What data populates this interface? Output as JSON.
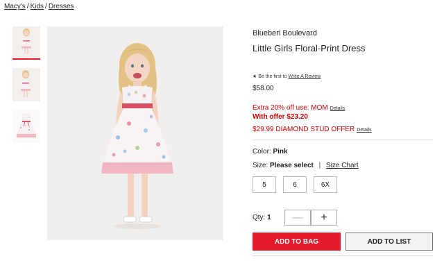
{
  "breadcrumb": {
    "items": [
      "Macy's",
      "Kids",
      "Dresses"
    ],
    "separator": "/"
  },
  "gallery": {
    "thumbnails": [
      "child-front-photo",
      "child-side-photo",
      "dress-flat-photo"
    ],
    "main_image": "child-in-floral-dress-photo"
  },
  "product": {
    "brand": "Blueberi Boulevard",
    "title": "Little Girls Floral-Print Dress",
    "review_prefix": "★ Be the first to",
    "review_link": "Write A Review",
    "price": "$58.00"
  },
  "promos": {
    "extra_off": "Extra 20% off use: MOM",
    "extra_details": "Details",
    "with_offer": "With offer $23.20",
    "diamond": "$29.99 DIAMOND STUD OFFER",
    "diamond_details": "Details"
  },
  "options": {
    "color_label": "Color:",
    "color_value": "Pink",
    "size_label": "Size:",
    "size_value": "Please select",
    "size_sep": "|",
    "size_chart": "Size Chart",
    "sizes": [
      "5",
      "6",
      "6X"
    ]
  },
  "quantity": {
    "label": "Qty:",
    "value": "1",
    "minus": "—",
    "plus": "+"
  },
  "actions": {
    "add_to_bag": "ADD TO BAG",
    "add_to_list": "ADD TO LIST"
  },
  "colors": {
    "accent_red": "#e21a2c",
    "promo_red": "#cc0000"
  }
}
